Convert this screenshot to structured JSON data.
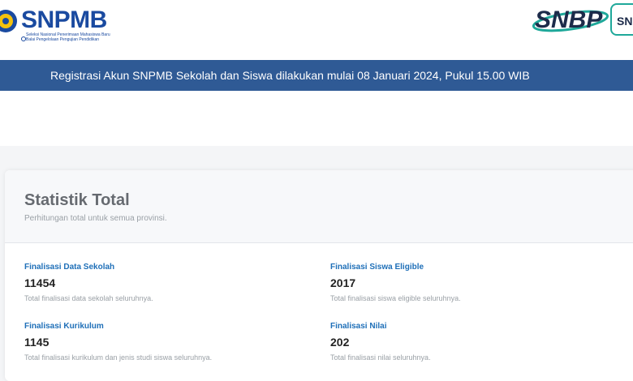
{
  "header": {
    "brand": "SNPMB",
    "brand_sub1": "Seleksi Nasional Penerimaan Mahasiswa Baru",
    "brand_sub2": "Balai Pengelolaan Pengujian Pendidikan",
    "right_logo": "SNBP",
    "right_badge": "SN"
  },
  "banner": {
    "text": "Registrasi Akun SNPMB Sekolah dan Siswa dilakukan mulai 08 Januari 2024, Pukul 15.00 WIB"
  },
  "card": {
    "title": "Statistik Total",
    "subtitle": "Perhitungan total untuk semua provinsi.",
    "stats": [
      {
        "label": "Finalisasi Data Sekolah",
        "value": "11454",
        "desc": "Total finalisasi data sekolah seluruhnya."
      },
      {
        "label": "Finalisasi Siswa Eligible",
        "value": "2017",
        "desc": "Total finalisasi siswa eligible seluruhnya."
      },
      {
        "label": "Finalisasi Kurikulum",
        "value": "1145",
        "desc": "Total finalisasi kurikulum dan jenis studi siswa seluruhnya."
      },
      {
        "label": "Finalisasi Nilai",
        "value": "202",
        "desc": "Total finalisasi nilai seluruhnya."
      }
    ]
  },
  "colors": {
    "banner_bg": "#2f5a95",
    "brand_blue": "#1a4aa0",
    "stat_label": "#1e6fb8",
    "teal": "#1fa89a"
  }
}
